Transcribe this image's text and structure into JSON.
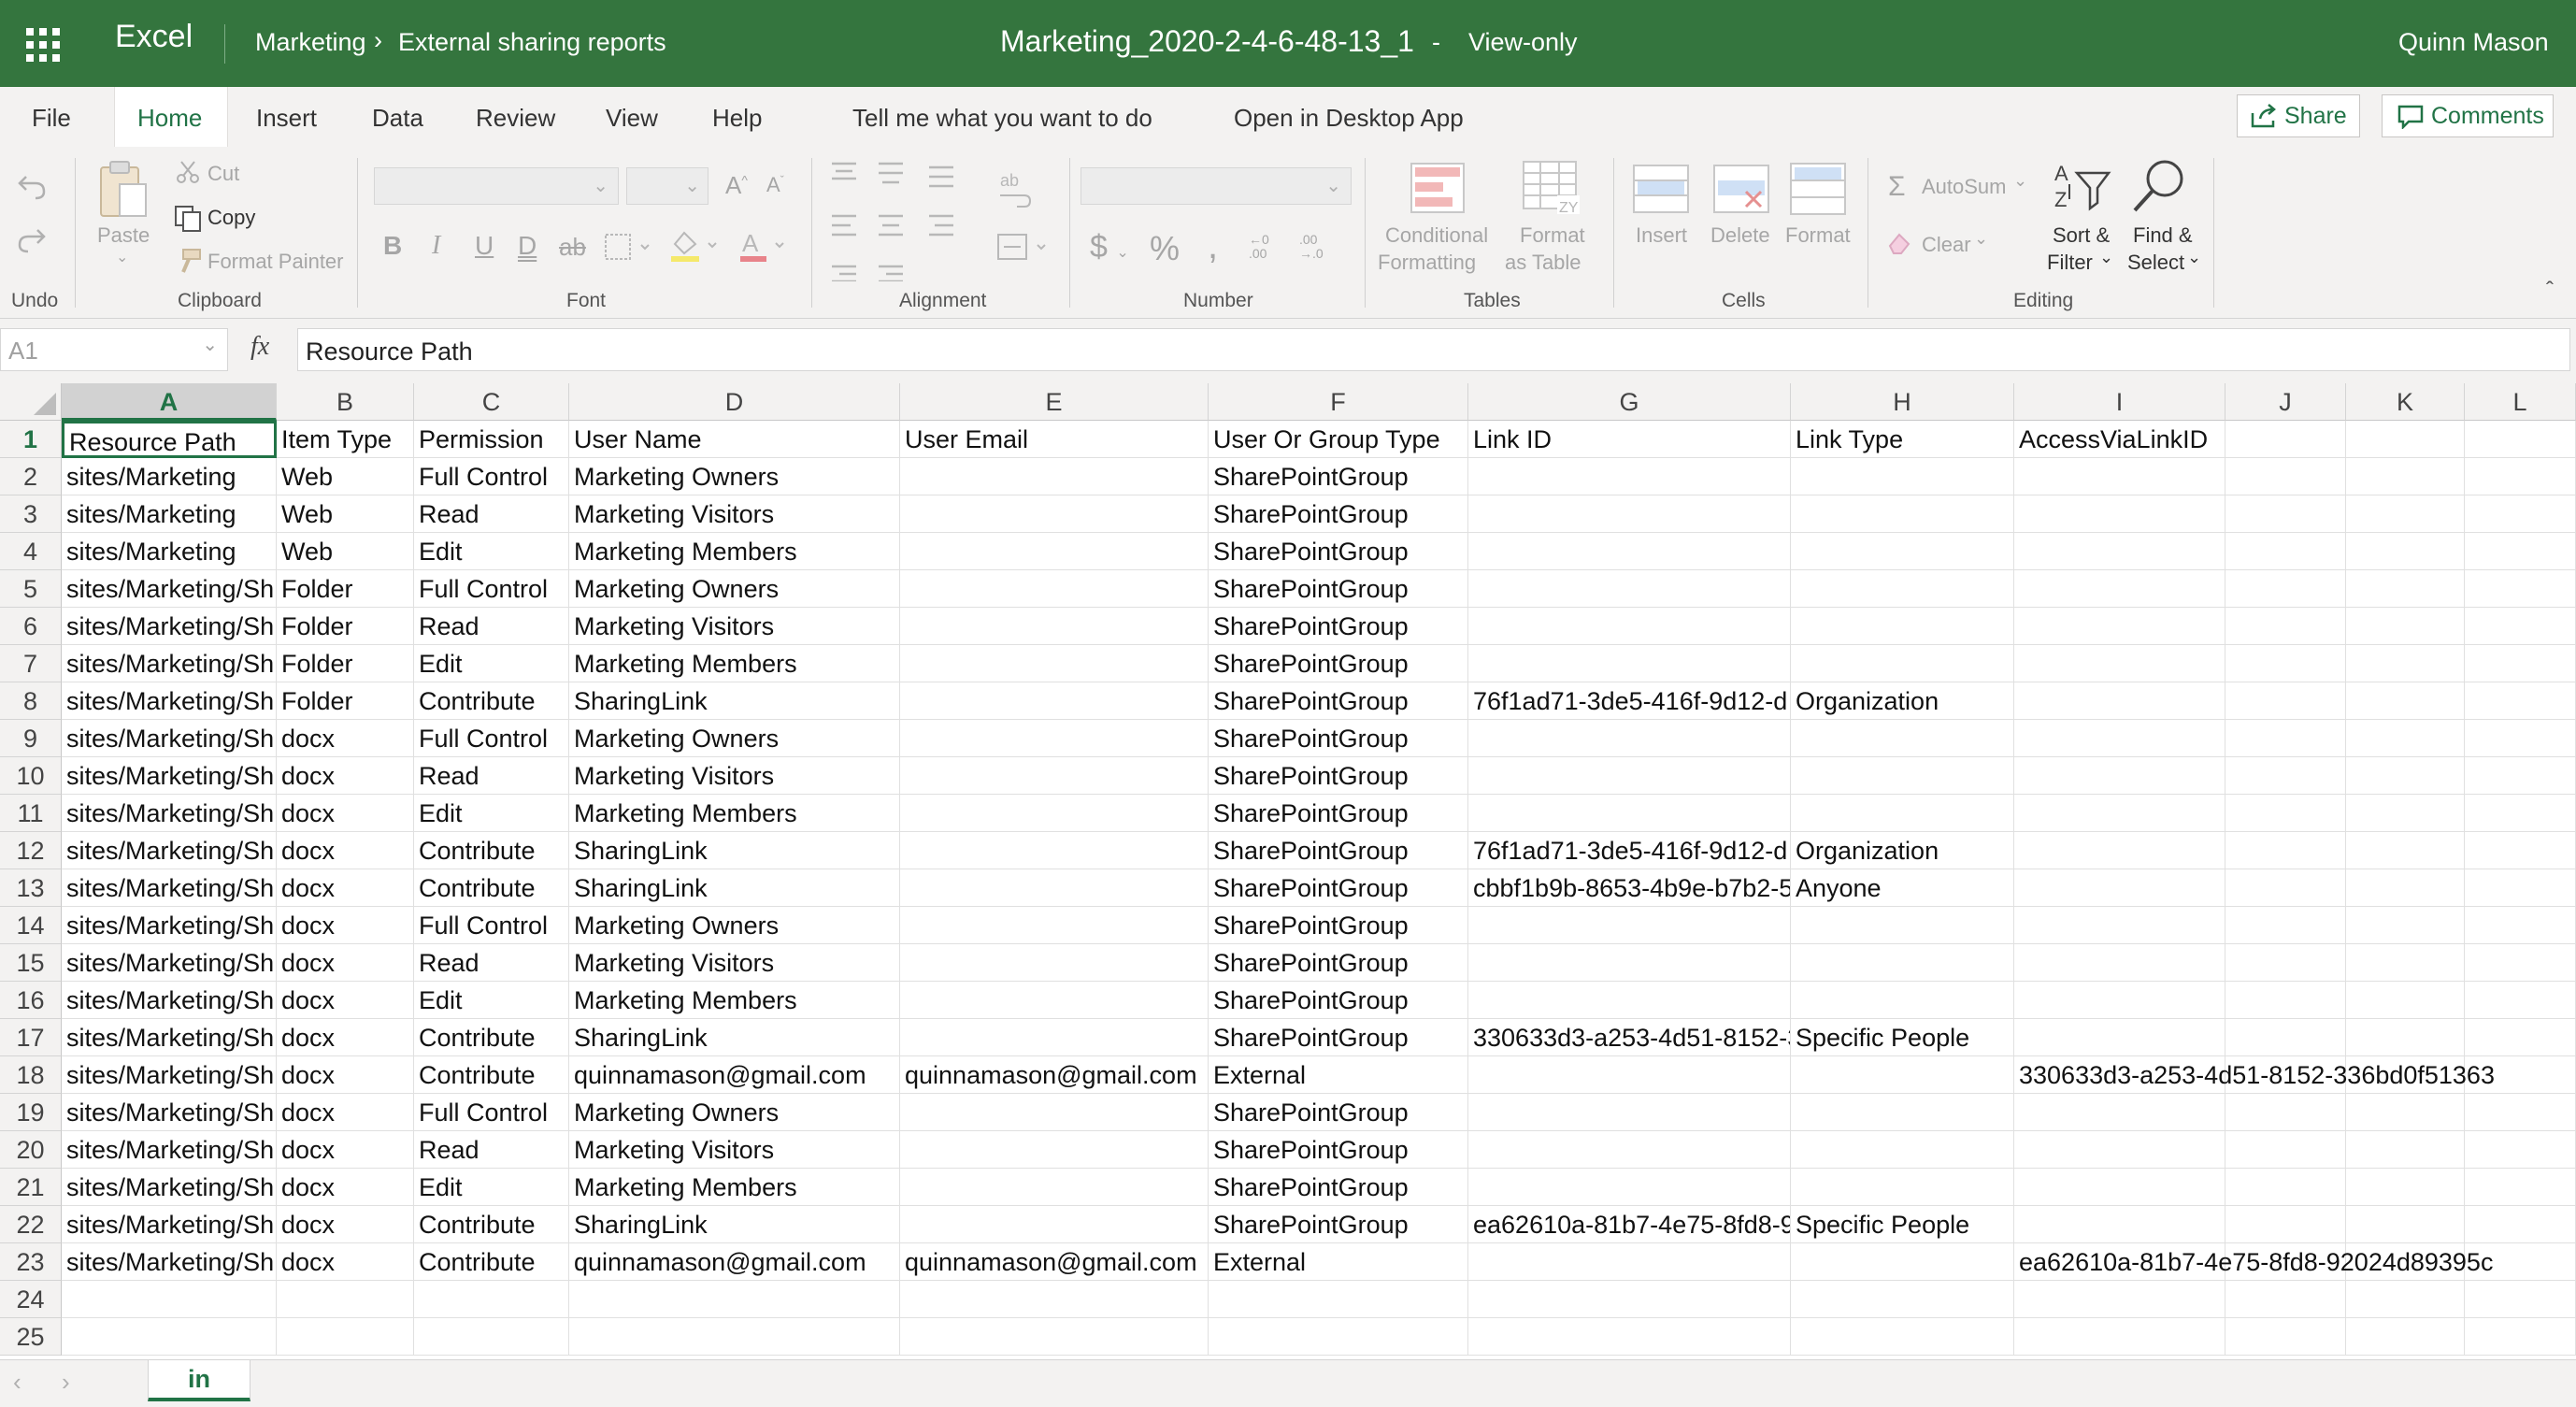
{
  "app": {
    "name": "Excel",
    "breadcrumb": [
      "Marketing",
      "External sharing reports"
    ],
    "doc_title": "Marketing_2020-2-4-6-48-13_1",
    "title_sep": "-",
    "mode": "View-only",
    "user": "Quinn Mason"
  },
  "menu": {
    "items": [
      "File",
      "Home",
      "Insert",
      "Data",
      "Review",
      "View",
      "Help"
    ],
    "active": "Home",
    "tell_me": "Tell me what you want to do",
    "open_desktop": "Open in Desktop App",
    "share": "Share",
    "comments": "Comments"
  },
  "ribbon": {
    "groups": [
      "Undo",
      "Clipboard",
      "Font",
      "Alignment",
      "Number",
      "Tables",
      "Cells",
      "Editing"
    ],
    "paste": "Paste",
    "cut": "Cut",
    "copy": "Copy",
    "format_painter": "Format Painter",
    "cond_fmt_1": "Conditional",
    "cond_fmt_2": "Formatting",
    "fmt_table_1": "Format",
    "fmt_table_2": "as Table",
    "insert": "Insert",
    "delete": "Delete",
    "format": "Format",
    "autosum": "AutoSum",
    "clear": "Clear",
    "sort_1": "Sort &",
    "sort_2": "Filter",
    "find_1": "Find &",
    "find_2": "Select",
    "font_buttons": [
      "B",
      "I",
      "U",
      "D",
      "ab"
    ]
  },
  "formula_bar": {
    "name_box": "A1",
    "fx": "fx",
    "value": "Resource Path"
  },
  "columns": [
    "A",
    "B",
    "C",
    "D",
    "E",
    "F",
    "G",
    "H",
    "I",
    "J",
    "K",
    "L"
  ],
  "row_numbers": [
    "1",
    "2",
    "3",
    "4",
    "5",
    "6",
    "7",
    "8",
    "9",
    "10",
    "11",
    "12",
    "13",
    "14",
    "15",
    "16",
    "17",
    "18",
    "19",
    "20",
    "21",
    "22",
    "23",
    "24",
    "25"
  ],
  "rows": [
    [
      "Resource Path",
      "Item Type",
      "Permission",
      "User Name",
      "User Email",
      "User Or Group Type",
      "Link ID",
      "Link Type",
      "AccessViaLinkID"
    ],
    [
      "sites/Marketing",
      "Web",
      "Full Control",
      "Marketing Owners",
      "",
      "SharePointGroup",
      "",
      "",
      ""
    ],
    [
      "sites/Marketing",
      "Web",
      "Read",
      "Marketing Visitors",
      "",
      "SharePointGroup",
      "",
      "",
      ""
    ],
    [
      "sites/Marketing",
      "Web",
      "Edit",
      "Marketing Members",
      "",
      "SharePointGroup",
      "",
      "",
      ""
    ],
    [
      "sites/Marketing/Sh",
      "Folder",
      "Full Control",
      "Marketing Owners",
      "",
      "SharePointGroup",
      "",
      "",
      ""
    ],
    [
      "sites/Marketing/Sh",
      "Folder",
      "Read",
      "Marketing Visitors",
      "",
      "SharePointGroup",
      "",
      "",
      ""
    ],
    [
      "sites/Marketing/Sh",
      "Folder",
      "Edit",
      "Marketing Members",
      "",
      "SharePointGroup",
      "",
      "",
      ""
    ],
    [
      "sites/Marketing/Sh",
      "Folder",
      "Contribute",
      "SharingLink",
      "",
      "SharePointGroup",
      "76f1ad71-3de5-416f-9d12-d",
      "Organization",
      ""
    ],
    [
      "sites/Marketing/Sh",
      "docx",
      "Full Control",
      "Marketing Owners",
      "",
      "SharePointGroup",
      "",
      "",
      ""
    ],
    [
      "sites/Marketing/Sh",
      "docx",
      "Read",
      "Marketing Visitors",
      "",
      "SharePointGroup",
      "",
      "",
      ""
    ],
    [
      "sites/Marketing/Sh",
      "docx",
      "Edit",
      "Marketing Members",
      "",
      "SharePointGroup",
      "",
      "",
      ""
    ],
    [
      "sites/Marketing/Sh",
      "docx",
      "Contribute",
      "SharingLink",
      "",
      "SharePointGroup",
      "76f1ad71-3de5-416f-9d12-d",
      "Organization",
      ""
    ],
    [
      "sites/Marketing/Sh",
      "docx",
      "Contribute",
      "SharingLink",
      "",
      "SharePointGroup",
      "cbbf1b9b-8653-4b9e-b7b2-5",
      "Anyone",
      ""
    ],
    [
      "sites/Marketing/Sh",
      "docx",
      "Full Control",
      "Marketing Owners",
      "",
      "SharePointGroup",
      "",
      "",
      ""
    ],
    [
      "sites/Marketing/Sh",
      "docx",
      "Read",
      "Marketing Visitors",
      "",
      "SharePointGroup",
      "",
      "",
      ""
    ],
    [
      "sites/Marketing/Sh",
      "docx",
      "Edit",
      "Marketing Members",
      "",
      "SharePointGroup",
      "",
      "",
      ""
    ],
    [
      "sites/Marketing/Sh",
      "docx",
      "Contribute",
      "SharingLink",
      "",
      "SharePointGroup",
      "330633d3-a253-4d51-8152-3",
      "Specific People",
      ""
    ],
    [
      "sites/Marketing/Sh",
      "docx",
      "Contribute",
      "quinnamason@gmail.com",
      "quinnamason@gmail.com",
      "External",
      "",
      "",
      "330633d3-a253-4d51-8152-336bd0f51363"
    ],
    [
      "sites/Marketing/Sh",
      "docx",
      "Full Control",
      "Marketing Owners",
      "",
      "SharePointGroup",
      "",
      "",
      ""
    ],
    [
      "sites/Marketing/Sh",
      "docx",
      "Read",
      "Marketing Visitors",
      "",
      "SharePointGroup",
      "",
      "",
      ""
    ],
    [
      "sites/Marketing/Sh",
      "docx",
      "Edit",
      "Marketing Members",
      "",
      "SharePointGroup",
      "",
      "",
      ""
    ],
    [
      "sites/Marketing/Sh",
      "docx",
      "Contribute",
      "SharingLink",
      "",
      "SharePointGroup",
      "ea62610a-81b7-4e75-8fd8-9",
      "Specific People",
      ""
    ],
    [
      "sites/Marketing/Sh",
      "docx",
      "Contribute",
      "quinnamason@gmail.com",
      "quinnamason@gmail.com",
      "External",
      "",
      "",
      "ea62610a-81b7-4e75-8fd8-92024d89395c"
    ],
    [
      "",
      "",
      "",
      "",
      "",
      "",
      "",
      "",
      ""
    ],
    [
      "",
      "",
      "",
      "",
      "",
      "",
      "",
      "",
      ""
    ]
  ],
  "sheet_tabs": [
    "in"
  ],
  "colors": {
    "brand": "#34753e",
    "accent": "#217346"
  }
}
